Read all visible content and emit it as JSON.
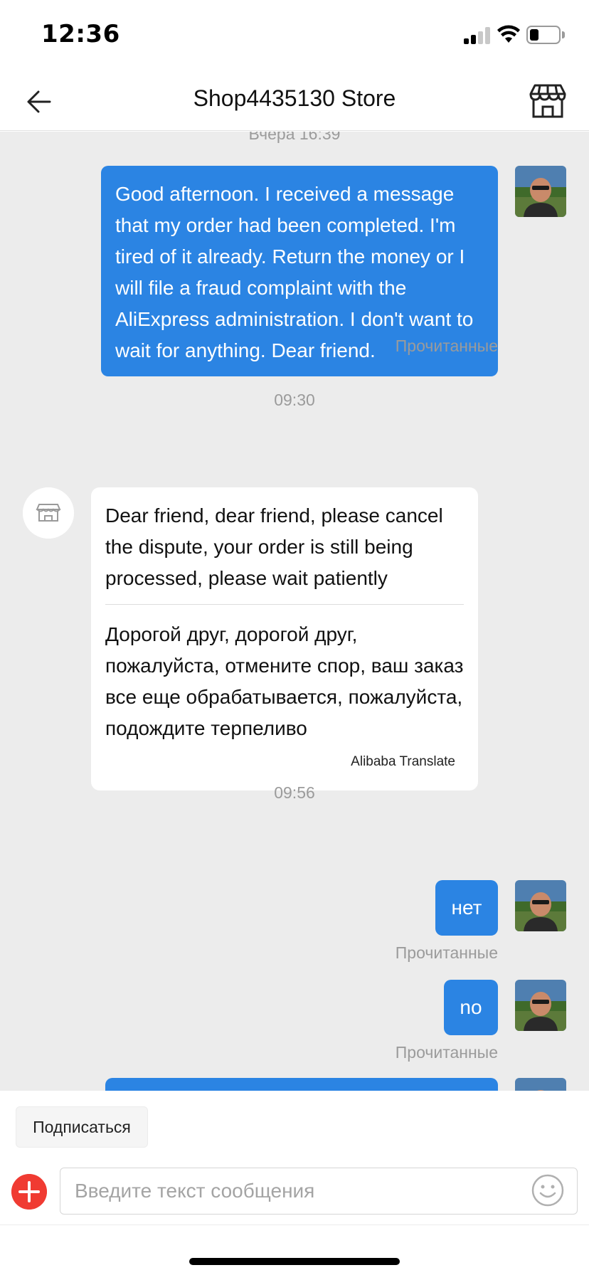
{
  "status_bar": {
    "time": "12:36"
  },
  "header": {
    "title": "Shop4435130 Store"
  },
  "messages": [
    {
      "type": "timestamp",
      "text": "Вчера 16:39"
    },
    {
      "type": "outgoing",
      "text": "Good afternoon. I received a message that my order had been completed. I'm tired of it already. Return the money or I will file a fraud complaint with the AliExpress administration. I don't want to wait for anything. Dear friend.",
      "status": "Прочитанные"
    },
    {
      "type": "timestamp",
      "text": "09:30"
    },
    {
      "type": "incoming",
      "original": "Dear friend, dear friend, please cancel the dispute, your order is still being processed, please wait patiently",
      "translation": "Дорогой друг, дорогой друг, пожалуйста, отмените спор, ваш заказ все еще обрабатывается, пожалуйста, подождите терпеливо",
      "translator": "Alibaba Translate"
    },
    {
      "type": "timestamp",
      "text": "09:56"
    },
    {
      "type": "outgoing",
      "text": "нет",
      "status": "Прочитанные"
    },
    {
      "type": "outgoing",
      "text": "no",
      "status": "Прочитанные"
    }
  ],
  "bottom": {
    "subscribe_label": "Подписаться",
    "input_placeholder": "Введите текст сообщения"
  },
  "colors": {
    "accent_blue": "#2b84e3",
    "plus_red": "#f03b32",
    "chat_background": "#ececec"
  },
  "icons": [
    "back-arrow-icon",
    "store-icon",
    "shop-avatar-icon",
    "plus-icon",
    "emoji-icon",
    "signal-icon",
    "wifi-icon",
    "battery-icon"
  ]
}
